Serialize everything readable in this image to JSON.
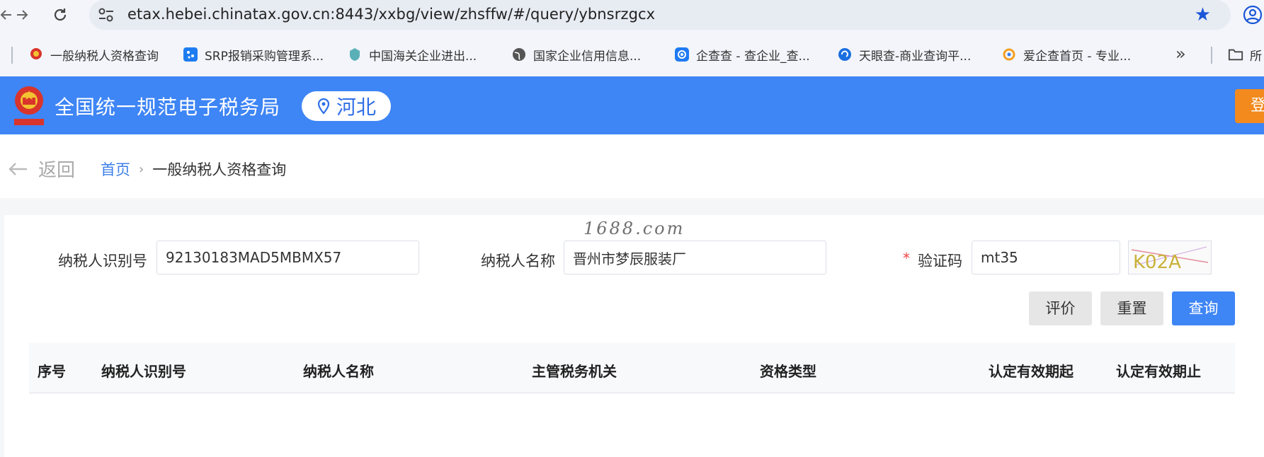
{
  "browser": {
    "url": "etax.hebei.chinatax.gov.cn:8443/xxbg/view/zhsffw/#/query/ybnsrzgcx",
    "back_icon": "arrow-left-icon",
    "forward_icon": "arrow-right-icon",
    "reload_icon": "reload-icon",
    "bookmarks": [
      {
        "label": "一般纳税人资格查询",
        "icon": "tax-emblem-icon"
      },
      {
        "label": "SRP报销采购管理系...",
        "icon": "srp-icon"
      },
      {
        "label": "中国海关企业进出...",
        "icon": "customs-icon"
      },
      {
        "label": "国家企业信用信息...",
        "icon": "globe-icon"
      },
      {
        "label": "企查查 - 查企业_查...",
        "icon": "qichacha-icon"
      },
      {
        "label": "天眼查-商业查询平...",
        "icon": "tianyancha-icon"
      },
      {
        "label": "爱企查首页 - 专业...",
        "icon": "aiqicha-icon"
      }
    ],
    "more_glyph": "»",
    "folder_label": "所"
  },
  "header": {
    "title": "全国统一规范电子税务局",
    "region": "河北",
    "login_label": "登",
    "colors": {
      "bar": "#3e85f5",
      "login": "#f28a1e"
    }
  },
  "breadcrumb": {
    "back_label": "返回",
    "home": "首页",
    "separator": "›",
    "current": "一般纳税人资格查询"
  },
  "watermark": "1688.com",
  "form": {
    "taxpayer_id_label": "纳税人识别号",
    "taxpayer_id_value": "92130183MAD5MBMX57",
    "taxpayer_name_label": "纳税人名称",
    "taxpayer_name_value": "晋州市梦辰服装厂",
    "required_mark": "*",
    "captcha_label": "验证码",
    "captcha_value": "mt35",
    "captcha_image_text": "K02A"
  },
  "buttons": {
    "evaluate": "评价",
    "reset": "重置",
    "query": "查询"
  },
  "table": {
    "columns": [
      "序号",
      "纳税人识别号",
      "纳税人名称",
      "主管税务机关",
      "资格类型",
      "认定有效期起",
      "认定有效期止"
    ]
  }
}
